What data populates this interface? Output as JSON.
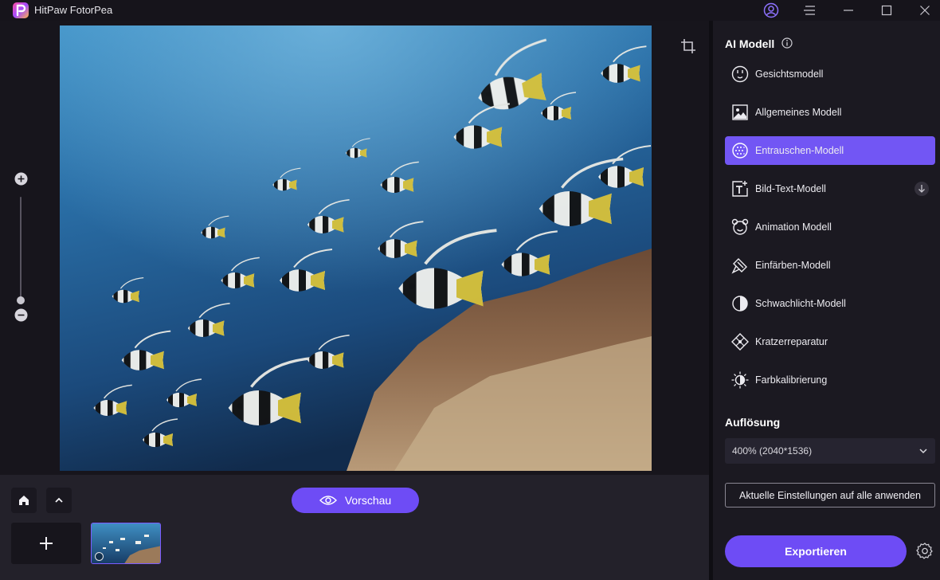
{
  "app": {
    "title": "HitPaw FotorPea"
  },
  "canvas": {
    "photo_alt": ""
  },
  "bottom": {
    "preview_label": "Vorschau"
  },
  "panel": {
    "ai_title": "AI Modell",
    "models": [
      {
        "label": "Gesichtsmodell",
        "icon": "face-icon",
        "active": false
      },
      {
        "label": "Allgemeines Modell",
        "icon": "image-icon",
        "active": false
      },
      {
        "label": "Entrauschen-Modell",
        "icon": "denoise-icon",
        "active": true
      },
      {
        "label": "Bild-Text-Modell",
        "icon": "text-image-icon",
        "active": false,
        "download": true
      },
      {
        "label": "Animation Modell",
        "icon": "animation-icon",
        "active": false
      },
      {
        "label": "Einfärben-Modell",
        "icon": "colorize-icon",
        "active": false
      },
      {
        "label": "Schwachlicht-Modell",
        "icon": "lowlight-icon",
        "active": false
      },
      {
        "label": "Kratzerreparatur",
        "icon": "scratch-icon",
        "active": false
      },
      {
        "label": "Farbkalibrierung",
        "icon": "color-calibration-icon",
        "active": false
      }
    ],
    "resolution_title": "Auflösung",
    "resolution_value": "400% (2040*1536)",
    "apply_label": "Aktuelle Einstellungen auf alle anwenden",
    "export_label": "Exportieren"
  },
  "colors": {
    "accent": "#6e4cf5",
    "active_item": "#7256f4",
    "panel_bg": "#1b1921"
  }
}
